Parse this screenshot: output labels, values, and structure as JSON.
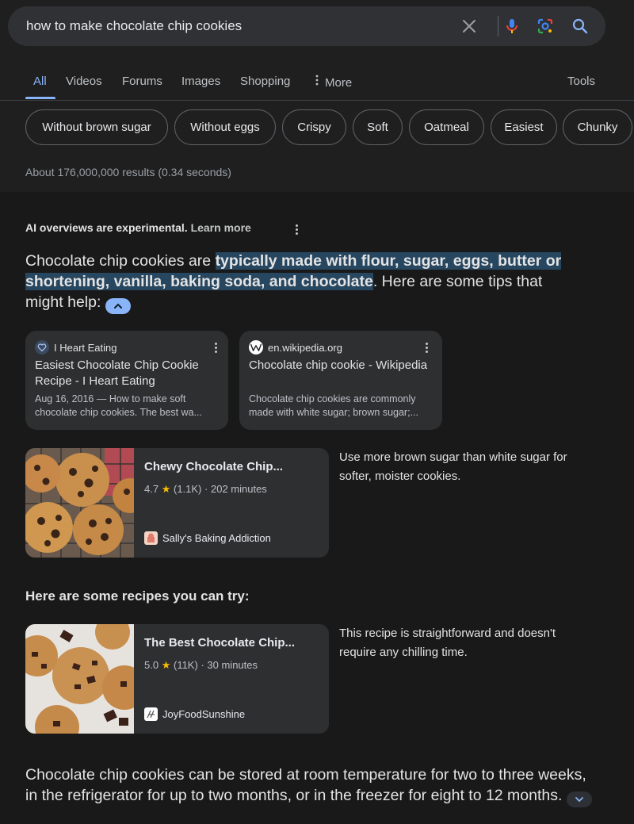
{
  "search": {
    "query": "how to make chocolate chip cookies",
    "icons": [
      "close-icon",
      "mic-icon",
      "lens-icon",
      "search-icon"
    ]
  },
  "tabs": [
    {
      "label": "All",
      "active": true
    },
    {
      "label": "Videos"
    },
    {
      "label": "Forums"
    },
    {
      "label": "Images"
    },
    {
      "label": "Shopping"
    },
    {
      "label": "More"
    },
    {
      "label": "Tools"
    }
  ],
  "chips": [
    "Without brown sugar",
    "Without eggs",
    "Crispy",
    "Soft",
    "Oatmeal",
    "Easiest",
    "Chunky"
  ],
  "results_count": "About 176,000,000 results (0.34 seconds)",
  "ai_overview": {
    "label": "AI overviews are experimental.",
    "learn_more": "Learn more",
    "intro_pre": "Chocolate chip cookies are ",
    "intro_highlight": "typically made with flour, sugar, eggs, butter or shortening, vanilla, baking soda, and chocolate",
    "intro_post": ". Here are some tips that might help:",
    "sources": [
      {
        "site": "I Heart Eating",
        "title": "Easiest Chocolate Chip Cookie Recipe - I Heart Eating",
        "snippet": "Aug 16, 2016 — How to make soft chocolate chip cookies. The best wa..."
      },
      {
        "site": "en.wikipedia.org",
        "title": "Chocolate chip cookie - Wikipedia",
        "snippet": "Chocolate chip cookies are commonly made with white sugar; brown sugar;..."
      }
    ],
    "recipes_heading": "Here are some recipes you can try:",
    "recipes": [
      {
        "title": "Chewy Chocolate Chip...",
        "rating": "4.7",
        "reviews": "(1.1K)",
        "time": "202 minutes",
        "source": "Sally's Baking Addiction",
        "tip": "Use more brown sugar than white sugar for softer, moister cookies."
      },
      {
        "title": "The Best Chocolate Chip...",
        "rating": "5.0",
        "reviews": "(11K)",
        "time": "30 minutes",
        "source": "JoyFoodSunshine",
        "tip": "This recipe is straightforward and doesn't require any chilling time."
      }
    ],
    "storage_text": "Chocolate chip cookies can be stored at room temperature for two to three weeks, in the refrigerator for up to two months, or in the freezer for eight to 12 months."
  },
  "colors": {
    "accent": "#8ab4f8",
    "highlight_bg": "#27465f",
    "star": "#fbbc04"
  }
}
